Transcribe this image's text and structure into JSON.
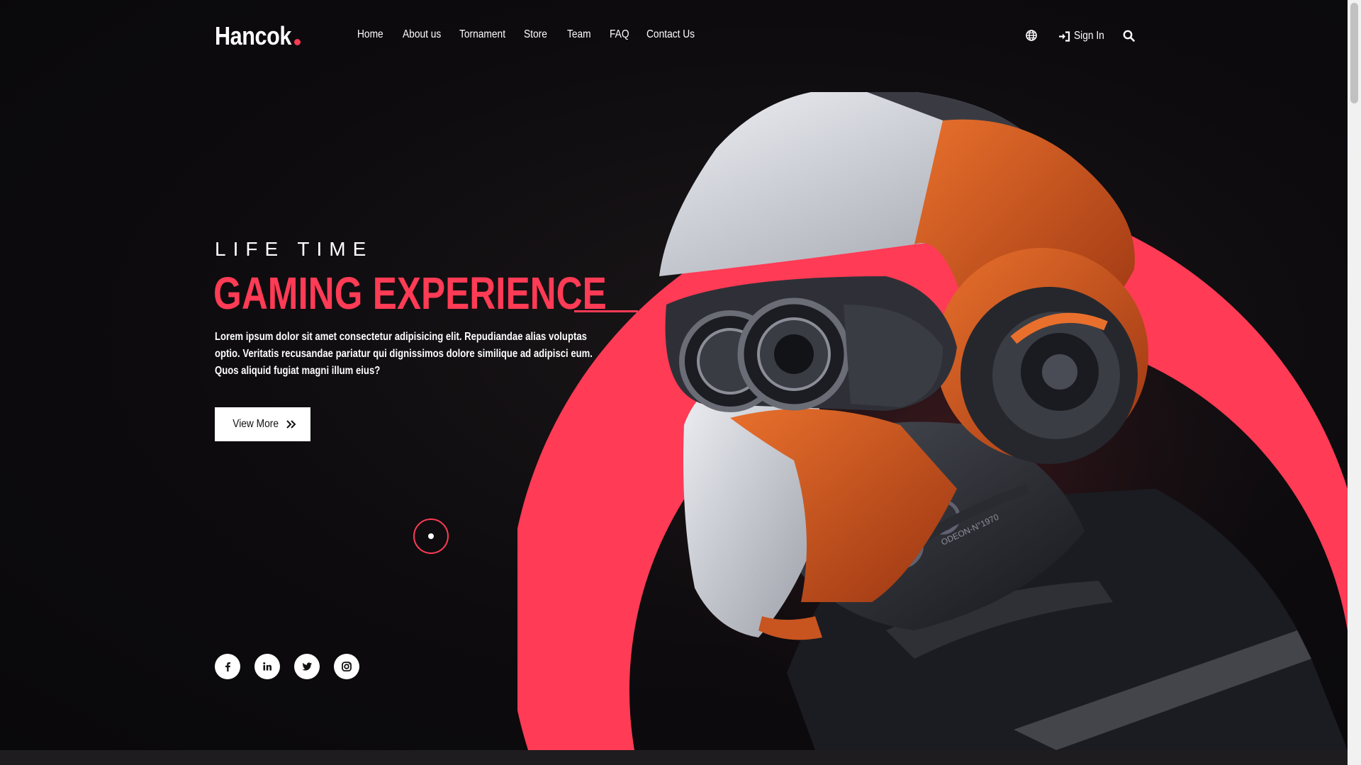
{
  "header": {
    "logo": "Hancok",
    "nav": [
      {
        "label": "Home"
      },
      {
        "label": "About us"
      },
      {
        "label": "Tornament"
      },
      {
        "label": "Store"
      },
      {
        "label": "Team"
      },
      {
        "label": "FAQ"
      },
      {
        "label": "Contact Us"
      }
    ],
    "icons": {
      "language": "globe-icon",
      "signin": "sign-in-icon",
      "search": "search-icon"
    },
    "signin_label": "Sign In"
  },
  "hero": {
    "eyebrow": "LIFE TIME",
    "headline": "GAMING EXPERIENCE",
    "description": "Lorem ipsum dolor sit amet consectetur adipisicing elit. Repudiandae alias voluptas optio. Veritatis recusandae pariatur qui dignissimos dolore similique ad adipisci eum. Quos aliquid fugiat magni illum eius?",
    "button_label": "View More",
    "button_icon": "double-chevron-right-icon",
    "art_label": "ODEON-N°1970"
  },
  "socials": [
    {
      "name": "facebook-icon"
    },
    {
      "name": "linkedin-icon"
    },
    {
      "name": "twitter-icon"
    },
    {
      "name": "instagram-icon"
    }
  ],
  "colors": {
    "accent": "#ff3b55",
    "background": "#0c0a0d",
    "helmet_orange": "#d2581e",
    "helmet_white": "#d9dbe3"
  }
}
